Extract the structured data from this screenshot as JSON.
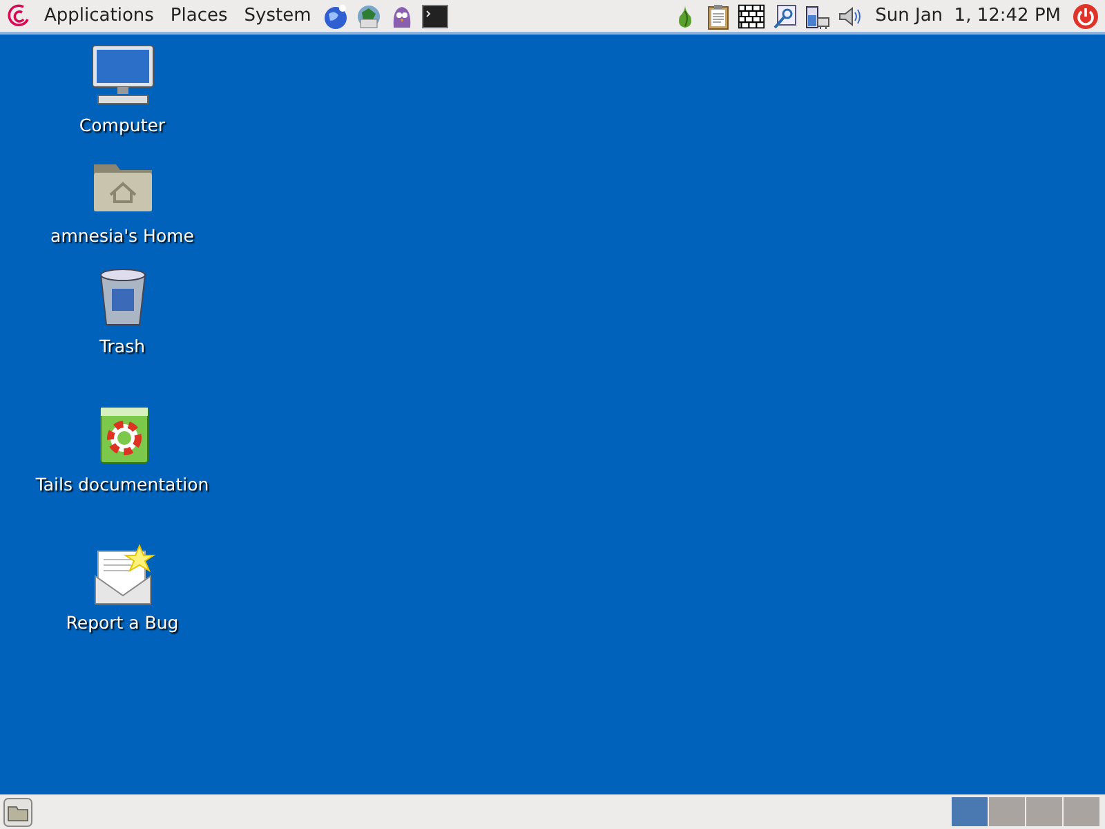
{
  "top_panel": {
    "menus": [
      {
        "label": "Applications"
      },
      {
        "label": "Places"
      },
      {
        "label": "System"
      }
    ],
    "clock": "Sun Jan  1, 12:42 PM"
  },
  "desktop_icons": [
    {
      "label": "Computer",
      "kind": "computer"
    },
    {
      "label": "amnesia's Home",
      "kind": "home"
    },
    {
      "label": "Trash",
      "kind": "trash"
    },
    {
      "label": "Tails documentation",
      "kind": "docs"
    },
    {
      "label": "Report a Bug",
      "kind": "bug"
    }
  ],
  "bottom_panel": {
    "workspaces": [
      {
        "selected": true
      },
      {
        "selected": false
      },
      {
        "selected": false
      },
      {
        "selected": false
      }
    ]
  }
}
